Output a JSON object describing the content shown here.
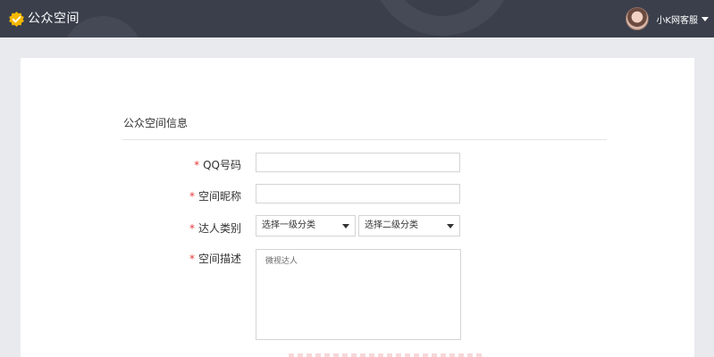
{
  "header": {
    "app_title": "公众空间",
    "user_name": "小K网客服",
    "logo_icon": "yellow-check-badge-icon",
    "avatar_icon": "user-avatar",
    "background_color": "#3a3f4b",
    "logo_color": "#f5b800"
  },
  "form": {
    "section_title": "公众空间信息",
    "required_mark": "*",
    "accent_color": "#e4393c",
    "fields": {
      "qq": {
        "label": "QQ号码",
        "value": ""
      },
      "nickname": {
        "label": "空间昵称",
        "value": ""
      },
      "category": {
        "label": "达人类别",
        "level1_selected": "选择一级分类",
        "level2_selected": "选择二级分类"
      },
      "description": {
        "label": "空间描述",
        "value": "微视达人"
      }
    }
  }
}
